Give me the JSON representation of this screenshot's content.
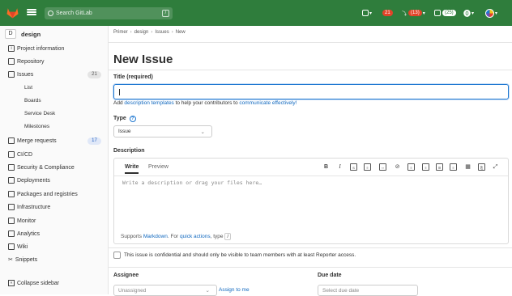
{
  "topbar": {
    "search_placeholder": "Search GitLab",
    "search_shortcut": "/",
    "issues_count": "21",
    "mr_count": "(13)",
    "todo_count": "(25)",
    "brand_color": "#2f7d3c"
  },
  "sidebar": {
    "project_initial": "D",
    "project_name": "design",
    "items": [
      {
        "label": "Project information",
        "icon": "info-icon"
      },
      {
        "label": "Repository",
        "icon": "repo-icon"
      },
      {
        "label": "Issues",
        "icon": "issues-icon",
        "count": "21"
      },
      {
        "label": "Merge requests",
        "icon": "merge-request-icon",
        "count": "17"
      },
      {
        "label": "CI/CD",
        "icon": "rocket-icon"
      },
      {
        "label": "Security & Compliance",
        "icon": "shield-icon"
      },
      {
        "label": "Deployments",
        "icon": "deploy-icon"
      },
      {
        "label": "Packages and registries",
        "icon": "package-icon"
      },
      {
        "label": "Infrastructure",
        "icon": "cloud-icon"
      },
      {
        "label": "Monitor",
        "icon": "monitor-icon"
      },
      {
        "label": "Analytics",
        "icon": "chart-icon"
      },
      {
        "label": "Wiki",
        "icon": "book-icon"
      },
      {
        "label": "Snippets",
        "icon": "scissors-icon"
      }
    ],
    "issue_subitems": [
      "List",
      "Boards",
      "Service Desk",
      "Milestones"
    ],
    "collapse_label": "Collapse sidebar"
  },
  "breadcrumb": [
    "Primer",
    "design",
    "Issues",
    "New"
  ],
  "page_title": "New Issue",
  "form": {
    "title_label": "Title (required)",
    "title_value": "",
    "template_prefix": "Add",
    "template_link1": "description templates",
    "template_mid": "to help your contributors to",
    "template_link2": "communicate effectively!",
    "type_label": "Type",
    "type_help": "?",
    "type_value": "Issue",
    "description_label": "Description",
    "write_tab": "Write",
    "preview_tab": "Preview",
    "description_placeholder": "Write a description or drag your files here…",
    "md_supports": "Supports",
    "md_markdown": "Markdown",
    "md_for": ". For",
    "md_quick": "quick actions",
    "md_type": ", type",
    "md_slash": "/",
    "confidential_text": "This issue is confidential and should only be visible to team members with at least Reporter access.",
    "assignee_label": "Assignee",
    "assignee_value": "Unassigned",
    "assign_to_me": "Assign to me",
    "due_label": "Due date",
    "due_placeholder": "Select due date"
  }
}
